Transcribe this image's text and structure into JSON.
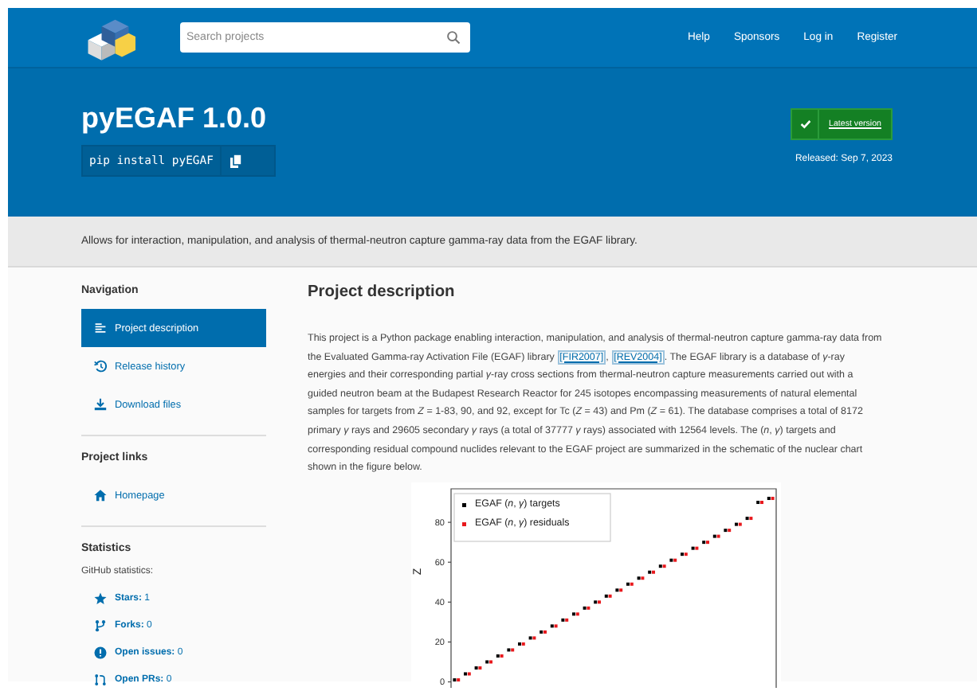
{
  "header": {
    "search": {
      "placeholder": "Search projects"
    },
    "nav": [
      "Help",
      "Sponsors",
      "Log in",
      "Register"
    ]
  },
  "banner": {
    "title": "pyEGAF 1.0.0",
    "install": "pip install pyEGAF",
    "latest": "Latest version",
    "released": "Released: Sep 7, 2023"
  },
  "summary": "Allows for interaction, manipulation, and analysis of thermal-neutron capture gamma-ray data from the EGAF library.",
  "sidebar": {
    "navigation": {
      "heading": "Navigation",
      "items": [
        {
          "label": "Project description",
          "selected": true
        },
        {
          "label": "Release history",
          "selected": false
        },
        {
          "label": "Download files",
          "selected": false
        }
      ]
    },
    "links": {
      "heading": "Project links",
      "items": [
        {
          "label": "Homepage"
        }
      ]
    },
    "statistics": {
      "heading": "Statistics",
      "subheading": "GitHub statistics:",
      "items": [
        {
          "text": "**Stars:** 1"
        },
        {
          "text": "**Forks:** 0"
        },
        {
          "text": "**Open issues:** 0"
        },
        {
          "text": "**Open PRs:** 0"
        }
      ]
    }
  },
  "description": {
    "heading": "Project description",
    "parts": [
      {
        "kind": "text",
        "text": "This project is a Python package enabling interaction, manipulation, and analysis of thermal-neutron capture gamma-ray data from the Evaluated Gamma-ray Activation File (EGAF) library "
      },
      {
        "kind": "link",
        "text": "[FIR2007]"
      },
      {
        "kind": "text",
        "text": ", "
      },
      {
        "kind": "link",
        "text": "[REV2004]"
      },
      {
        "kind": "text",
        "text": ". The EGAF library is a database of *γ*-ray energies and their corresponding partial *γ*-ray cross sections from thermal-neutron capture measurements carried out with a guided neutron beam at the Budapest Research Reactor for 245 isotopes encompassing measurements of natural elemental samples for targets from *Z* = 1-83, 90, and 92, except for Tc (*Z* = 43) and Pm (*Z* = 61). The database comprises a total of 8172 primary *γ* rays and 29605 secondary *γ* rays (a total of 37777 *γ* rays) associated with 12564 levels. The (*n*, *γ*) targets and corresponding residual compound nuclides relevant to the EGAF project are summarized in the schematic of the nuclear chart shown in the figure below."
      }
    ],
    "chart_data": {
      "type": "scatter",
      "ylabel": "Z",
      "yticks": [
        0,
        20,
        40,
        60,
        80
      ],
      "ylim": [
        -3,
        96
      ],
      "legend": true,
      "categories": [
        null,
        null,
        null,
        null,
        null,
        null,
        null,
        null,
        null,
        null,
        null,
        null,
        null,
        null,
        null,
        null,
        null,
        null,
        null,
        null,
        null,
        null,
        null,
        null,
        null,
        null,
        null,
        null,
        null,
        null
      ],
      "series": [
        {
          "name": "EGAF (*n*, *γ*) targets",
          "color": "#000000",
          "values": [
            1,
            4,
            7,
            10,
            13,
            16,
            19,
            22,
            25,
            28,
            31,
            34,
            37,
            40,
            43,
            46,
            49,
            52,
            55,
            58,
            61,
            64,
            67,
            70,
            73,
            76,
            79,
            82,
            90,
            92
          ]
        },
        {
          "name": "EGAF (*n*, *γ*) residuals",
          "color": "#e8191d",
          "values": [
            1,
            4,
            7,
            10,
            13,
            16,
            19,
            22,
            25,
            28,
            31,
            34,
            37,
            40,
            43,
            46,
            49,
            52,
            55,
            58,
            61,
            64,
            67,
            70,
            73,
            76,
            79,
            82,
            90,
            92
          ]
        }
      ]
    }
  }
}
